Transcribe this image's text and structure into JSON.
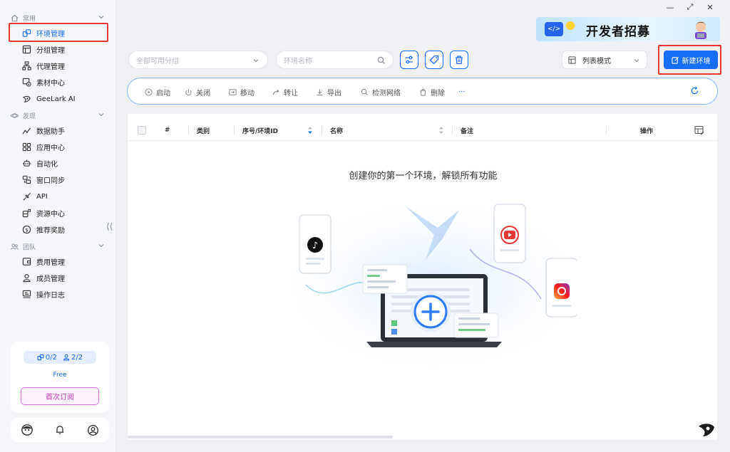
{
  "sidebar": {
    "groups": [
      {
        "title": "常用",
        "icon": "home-icon"
      },
      {
        "title": "发现",
        "icon": "planet-icon"
      },
      {
        "title": "团队",
        "icon": "team-icon"
      }
    ],
    "items": [
      {
        "label": "环境管理",
        "icon": "environment-icon",
        "active": true
      },
      {
        "label": "分组管理",
        "icon": "group-icon"
      },
      {
        "label": "代理管理",
        "icon": "proxy-icon"
      },
      {
        "label": "素材中心",
        "icon": "material-icon"
      },
      {
        "label": "GeeLark AI",
        "icon": "geelark-ai-icon"
      },
      {
        "label": "数据助手",
        "icon": "data-assistant-icon"
      },
      {
        "label": "应用中心",
        "icon": "app-center-icon"
      },
      {
        "label": "自动化",
        "icon": "automation-icon"
      },
      {
        "label": "窗口同步",
        "icon": "window-sync-icon"
      },
      {
        "label": "API",
        "icon": "api-icon"
      },
      {
        "label": "资源中心",
        "icon": "resource-center-icon"
      },
      {
        "label": "推荐奖励",
        "icon": "referral-reward-icon"
      },
      {
        "label": "费用管理",
        "icon": "billing-icon"
      },
      {
        "label": "成员管理",
        "icon": "member-icon"
      },
      {
        "label": "操作日志",
        "icon": "operation-log-icon"
      }
    ],
    "plan": {
      "env_count": "0/2",
      "member_count": "2/2",
      "name": "Free",
      "subscribe_label": "首次订阅"
    }
  },
  "banner": {
    "text": "开发者招募",
    "icon_text": "</>"
  },
  "toolbar": {
    "group_select_placeholder": "全部可用分组",
    "name_search_placeholder": "环境名称",
    "view_mode": "列表模式",
    "new_env_label": "新建环境"
  },
  "actions": [
    "启动",
    "关闭",
    "移动",
    "转让",
    "导出",
    "检测网络",
    "删除",
    "···"
  ],
  "table": {
    "columns": [
      "#",
      "类别",
      "序号/环境ID",
      "名称",
      "备注",
      "操作"
    ],
    "empty_text": "创建你的第一个环境，解锁所有功能"
  },
  "colors": {
    "accent": "#1a6df5",
    "highlight_border": "#e53935",
    "subscribe": "#c43bc2"
  }
}
